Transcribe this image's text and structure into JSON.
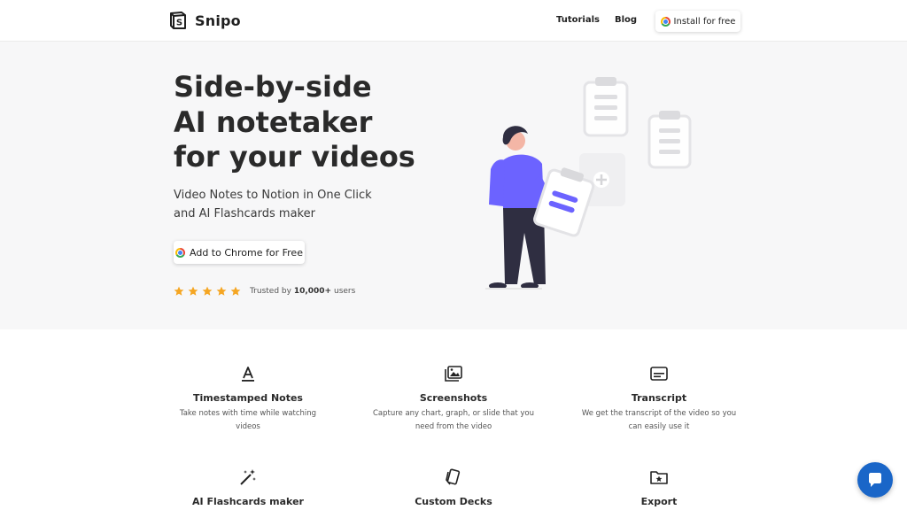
{
  "brand": {
    "name": "Snipo"
  },
  "nav": {
    "tutorials": "Tutorials",
    "blog": "Blog",
    "install": "Install for free"
  },
  "hero": {
    "title_lines": [
      "Side-by-side",
      "AI notetaker",
      "for your videos"
    ],
    "subtitle_lines": [
      "Video Notes to Notion in One Click",
      "and AI Flashcards maker"
    ],
    "cta": "Add to Chrome for Free",
    "rating": {
      "stars": 5,
      "trusted_prefix": "Trusted by",
      "trusted_count": "10,000+",
      "trusted_suffix": "users"
    }
  },
  "features": [
    {
      "icon": "text-format-icon",
      "title": "Timestamped Notes",
      "desc_lines": [
        "Take notes with time while watching",
        "videos"
      ]
    },
    {
      "icon": "images-icon",
      "title": "Screenshots",
      "desc_lines": [
        "Capture any chart, graph, or slide that you",
        "need from the video"
      ]
    },
    {
      "icon": "subtitles-icon",
      "title": "Transcript",
      "desc_lines": [
        "We get the transcript of the video so you",
        "can easily use it"
      ]
    },
    {
      "icon": "magic-wand-icon",
      "title": "AI Flashcards maker",
      "desc_lines": []
    },
    {
      "icon": "cards-icon",
      "title": "Custom Decks",
      "desc_lines": []
    },
    {
      "icon": "folder-star-icon",
      "title": "Export",
      "desc_lines": []
    }
  ],
  "colors": {
    "accent": "#6c63ff",
    "star": "#f5a623",
    "chat": "#1a66c8",
    "hero_bg": "#f7f7f8"
  }
}
